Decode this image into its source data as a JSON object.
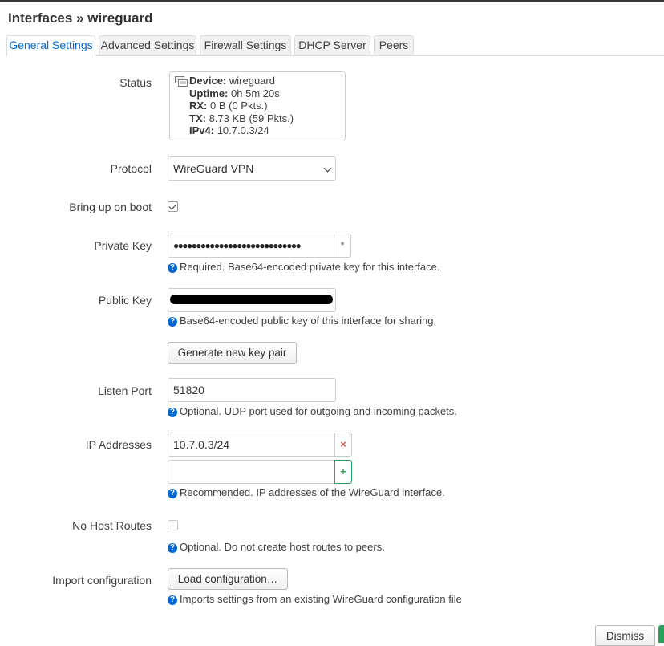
{
  "header": {
    "title": "Interfaces » wireguard"
  },
  "tabs": [
    {
      "label": "General Settings",
      "active": true
    },
    {
      "label": "Advanced Settings",
      "active": false
    },
    {
      "label": "Firewall Settings",
      "active": false
    },
    {
      "label": "DHCP Server",
      "active": false
    },
    {
      "label": "Peers",
      "active": false
    }
  ],
  "status": {
    "label": "Status",
    "device_key": "Device:",
    "device_value": "wireguard",
    "uptime_key": "Uptime:",
    "uptime_value": "0h 5m 20s",
    "rx_key": "RX:",
    "rx_value": "0 B (0 Pkts.)",
    "tx_key": "TX:",
    "tx_value": "8.73 KB (59 Pkts.)",
    "ipv4_key": "IPv4:",
    "ipv4_value": "10.7.0.3/24"
  },
  "protocol": {
    "label": "Protocol",
    "value": "WireGuard VPN"
  },
  "bring_up_on_boot": {
    "label": "Bring up on boot",
    "checked": true
  },
  "private_key": {
    "label": "Private Key",
    "value": "●●●●●●●●●●●●●●●●●●●●●●●●●●●●",
    "reveal": "*",
    "help": "Required. Base64-encoded private key for this interface."
  },
  "public_key": {
    "label": "Public Key",
    "value": "",
    "help": "Base64-encoded public key of this interface for sharing."
  },
  "generate_button": "Generate new key pair",
  "listen_port": {
    "label": "Listen Port",
    "value": "51820",
    "help": "Optional. UDP port used for outgoing and incoming packets."
  },
  "ip_addresses": {
    "label": "IP Addresses",
    "entries": [
      "10.7.0.3/24"
    ],
    "new_value": "",
    "remove": "×",
    "add": "+",
    "help": "Recommended. IP addresses of the WireGuard interface."
  },
  "no_host_routes": {
    "label": "No Host Routes",
    "checked": false,
    "help": "Optional. Do not create host routes to peers."
  },
  "import_configuration": {
    "label": "Import configuration",
    "button": "Load configuration…",
    "help": "Imports settings from an existing WireGuard configuration file"
  },
  "footer": {
    "dismiss": "Dismiss"
  },
  "colors": {
    "accent": "#0069d6",
    "add": "#27a05a",
    "remove": "#d9534f"
  },
  "icons": {
    "device": "network-device-icon",
    "help": "help-icon"
  }
}
